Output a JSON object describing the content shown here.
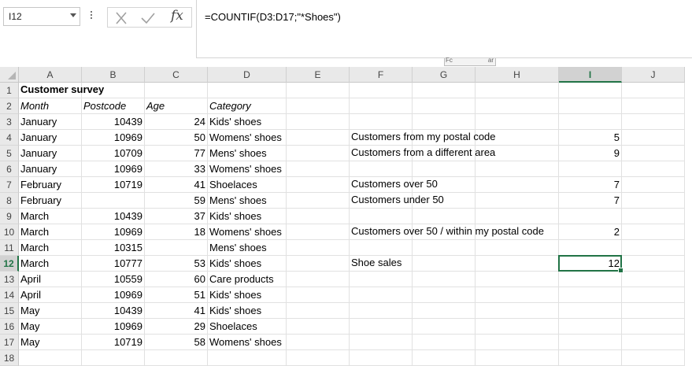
{
  "formula_bar": {
    "name_box": "I12",
    "fx_label": "fx",
    "formula": "=COUNTIF(D3:D17;\"*Shoes\")",
    "collapsed_handle_left": "Fc",
    "collapsed_handle_right": "ar"
  },
  "columns": [
    "A",
    "B",
    "C",
    "D",
    "E",
    "F",
    "G",
    "H",
    "I",
    "J"
  ],
  "selected_column": "I",
  "selected_row": 12,
  "rows": [
    1,
    2,
    3,
    4,
    5,
    6,
    7,
    8,
    9,
    10,
    11,
    12,
    13,
    14,
    15,
    16,
    17,
    18
  ],
  "sheet": {
    "title": "Customer survey",
    "headers": {
      "month": "Month",
      "postcode": "Postcode",
      "age": "Age",
      "category": "Category"
    },
    "records": [
      {
        "month": "January",
        "postcode": "10439",
        "age": "24",
        "category": "Kids' shoes"
      },
      {
        "month": "January",
        "postcode": "10969",
        "age": "50",
        "category": "Womens' shoes"
      },
      {
        "month": "January",
        "postcode": "10709",
        "age": "77",
        "category": "Mens' shoes"
      },
      {
        "month": "January",
        "postcode": "10969",
        "age": "33",
        "category": "Womens' shoes"
      },
      {
        "month": "February",
        "postcode": "10719",
        "age": "41",
        "category": "Shoelaces"
      },
      {
        "month": "February",
        "postcode": "",
        "age": "59",
        "category": "Mens' shoes"
      },
      {
        "month": "March",
        "postcode": "10439",
        "age": "37",
        "category": "Kids' shoes"
      },
      {
        "month": "March",
        "postcode": "10969",
        "age": "18",
        "category": "Womens' shoes"
      },
      {
        "month": "March",
        "postcode": "10315",
        "age": "",
        "category": "Mens' shoes"
      },
      {
        "month": "March",
        "postcode": "10777",
        "age": "53",
        "category": "Kids' shoes"
      },
      {
        "month": "April",
        "postcode": "10559",
        "age": "60",
        "category": "Care products"
      },
      {
        "month": "April",
        "postcode": "10969",
        "age": "51",
        "category": "Kids' shoes"
      },
      {
        "month": "May",
        "postcode": "10439",
        "age": "41",
        "category": "Kids' shoes"
      },
      {
        "month": "May",
        "postcode": "10969",
        "age": "29",
        "category": "Shoelaces"
      },
      {
        "month": "May",
        "postcode": "10719",
        "age": "58",
        "category": "Womens' shoes"
      }
    ],
    "summary": [
      {
        "row": 4,
        "label": "Customers from my postal code",
        "value": "5"
      },
      {
        "row": 5,
        "label": "Customers from a different area",
        "value": "9"
      },
      {
        "row": 7,
        "label": "Customers over 50",
        "value": "7"
      },
      {
        "row": 8,
        "label": "Customers under 50",
        "value": "7"
      },
      {
        "row": 10,
        "label": "Customers over 50 / within my postal code",
        "value": "2"
      },
      {
        "row": 12,
        "label": "Shoe sales",
        "value": "12"
      }
    ]
  }
}
